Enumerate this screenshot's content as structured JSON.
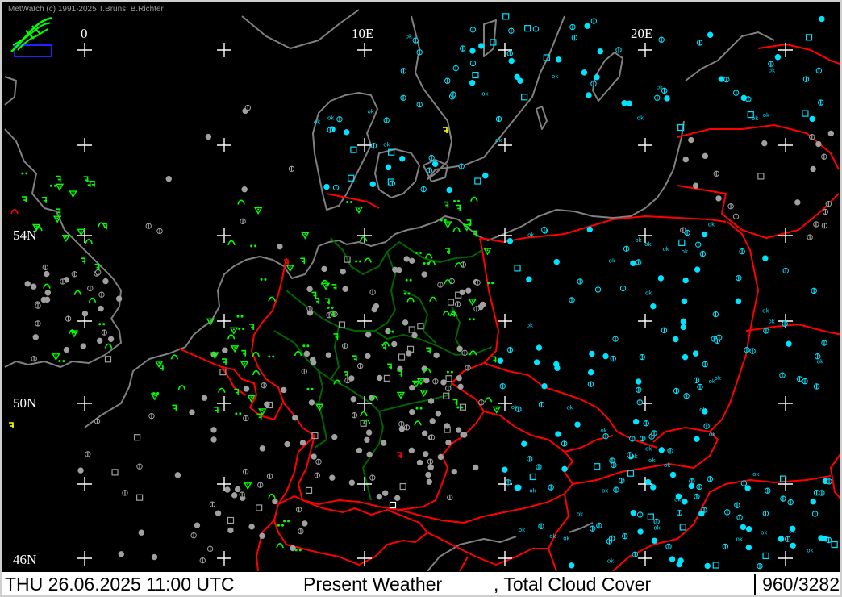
{
  "header": {
    "copyright": "MetWatch  (c) 1991-2025 T.Bruns, B.Richter"
  },
  "map": {
    "longitude_labels": [
      "0",
      "10E",
      "20E"
    ],
    "latitude_labels": [
      "54N",
      "50N",
      "46N"
    ],
    "colors": {
      "background": "#000000",
      "coastline": "#808080",
      "country_border": "#ff0000",
      "state_border": "#006400",
      "grid_cross": "#ffffff",
      "weather_symbol": "#00ff00",
      "cloud_clear": "#00e5ff",
      "cloud_overcast": "#a0a0a0",
      "special_symbol": "#ffff00"
    },
    "layer_symbols": [
      "station-cloud-cover",
      "present-weather-symbol",
      "grid-cross"
    ]
  },
  "status_bar": {
    "datetime": "THU 26.06.2025 11:00 UTC",
    "parameter1": "Present Weather",
    "parameter2": ", Total Cloud Cover",
    "count": "960/3282"
  }
}
